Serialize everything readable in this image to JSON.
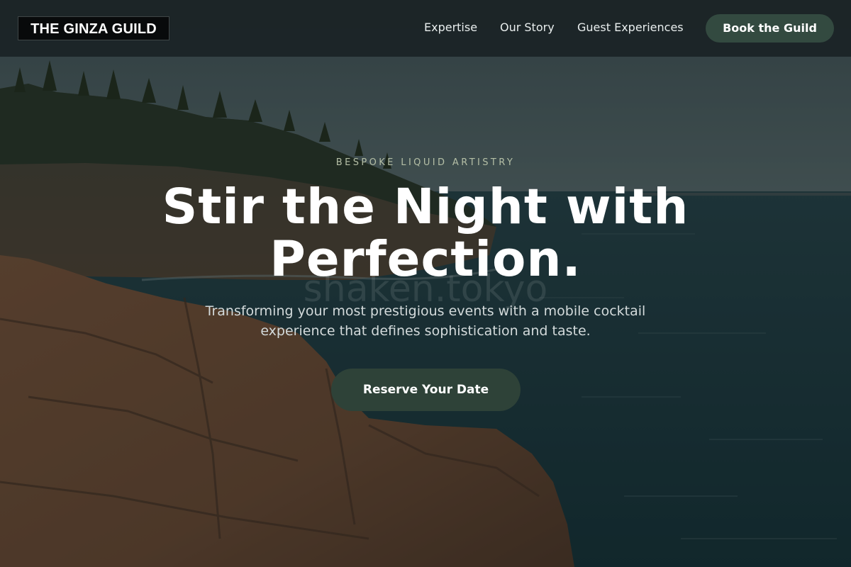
{
  "navbar": {
    "logo": "THE GINZA GUILD",
    "links": [
      "Expertise",
      "Our Story",
      "Guest Experiences"
    ],
    "cta_label": "Book the Guild"
  },
  "hero": {
    "eyebrow": "BESPOKE LIQUID ARTISTRY",
    "headline_line1": "Stir the Night with",
    "headline_line2": "Perfection.",
    "watermark": "shaken.tokyo",
    "subtitle_line1": "Transforming your most prestigious events with a mobile cocktail",
    "subtitle_line2": "experience that defines sophistication and taste.",
    "cta_label": "Reserve Your Date",
    "background": "coastal-cliff-photo"
  },
  "colors": {
    "nav_background": "#1b2426",
    "accent_button": "#334a40",
    "eyebrow_text": "#b5bfa6"
  }
}
